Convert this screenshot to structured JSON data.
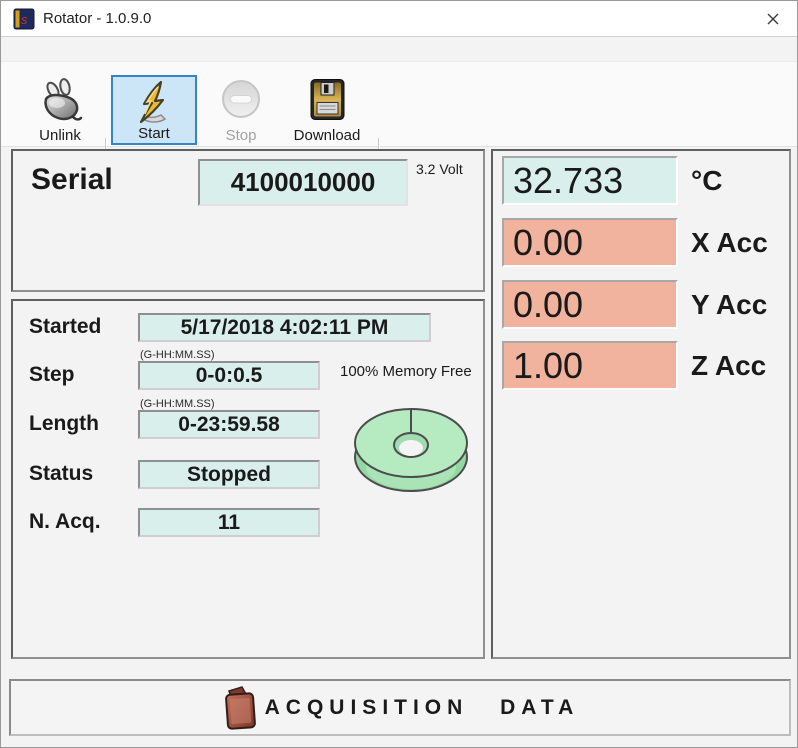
{
  "window": {
    "title": "Rotator - 1.0.9.0"
  },
  "toolbar": {
    "buttons": [
      {
        "label": "Unlink",
        "icon": "plug-icon",
        "state": "normal"
      },
      {
        "label": "Start",
        "icon": "lightning-icon",
        "state": "selected"
      },
      {
        "label": "Stop",
        "icon": "stop-icon",
        "state": "disabled"
      },
      {
        "label": "Download",
        "icon": "floppy-icon",
        "state": "normal"
      }
    ]
  },
  "serial_panel": {
    "label": "Serial",
    "value": "4100010000",
    "voltage": "3.2 Volt"
  },
  "readings": [
    {
      "value": "32.733",
      "unit": "°C",
      "color": "#d9efeb"
    },
    {
      "value": "0.00",
      "unit": "X Acc",
      "color": "#f1b39d"
    },
    {
      "value": "0.00",
      "unit": "Y Acc",
      "color": "#f1b39d"
    },
    {
      "value": "1.00",
      "unit": "Z Acc",
      "color": "#f1b39d"
    }
  ],
  "acquisition_panel": {
    "rows": [
      {
        "label": "Started",
        "value": "5/17/2018 4:02:11 PM"
      },
      {
        "label": "Step",
        "value": "0-0:0.5",
        "hint": "(G-HH:MM.SS)"
      },
      {
        "label": "Length",
        "value": "0-23:59.58",
        "hint": "(G-HH:MM.SS)"
      },
      {
        "label": "Status",
        "value": "Stopped"
      },
      {
        "label": "N. Acq.",
        "value": "11"
      }
    ],
    "memory_free": "100% Memory Free",
    "donut_icon": "memory-donut-chart",
    "donut_color": "#b6ebc1"
  },
  "footer": {
    "label": "ACQUISITION DATA",
    "icon": "folder-icon"
  },
  "colors": {
    "value_cyan": "#d9efeb",
    "value_salmon": "#f1b39d",
    "selected_button_bg": "#cde6f7",
    "selected_button_border": "#3584c4"
  }
}
